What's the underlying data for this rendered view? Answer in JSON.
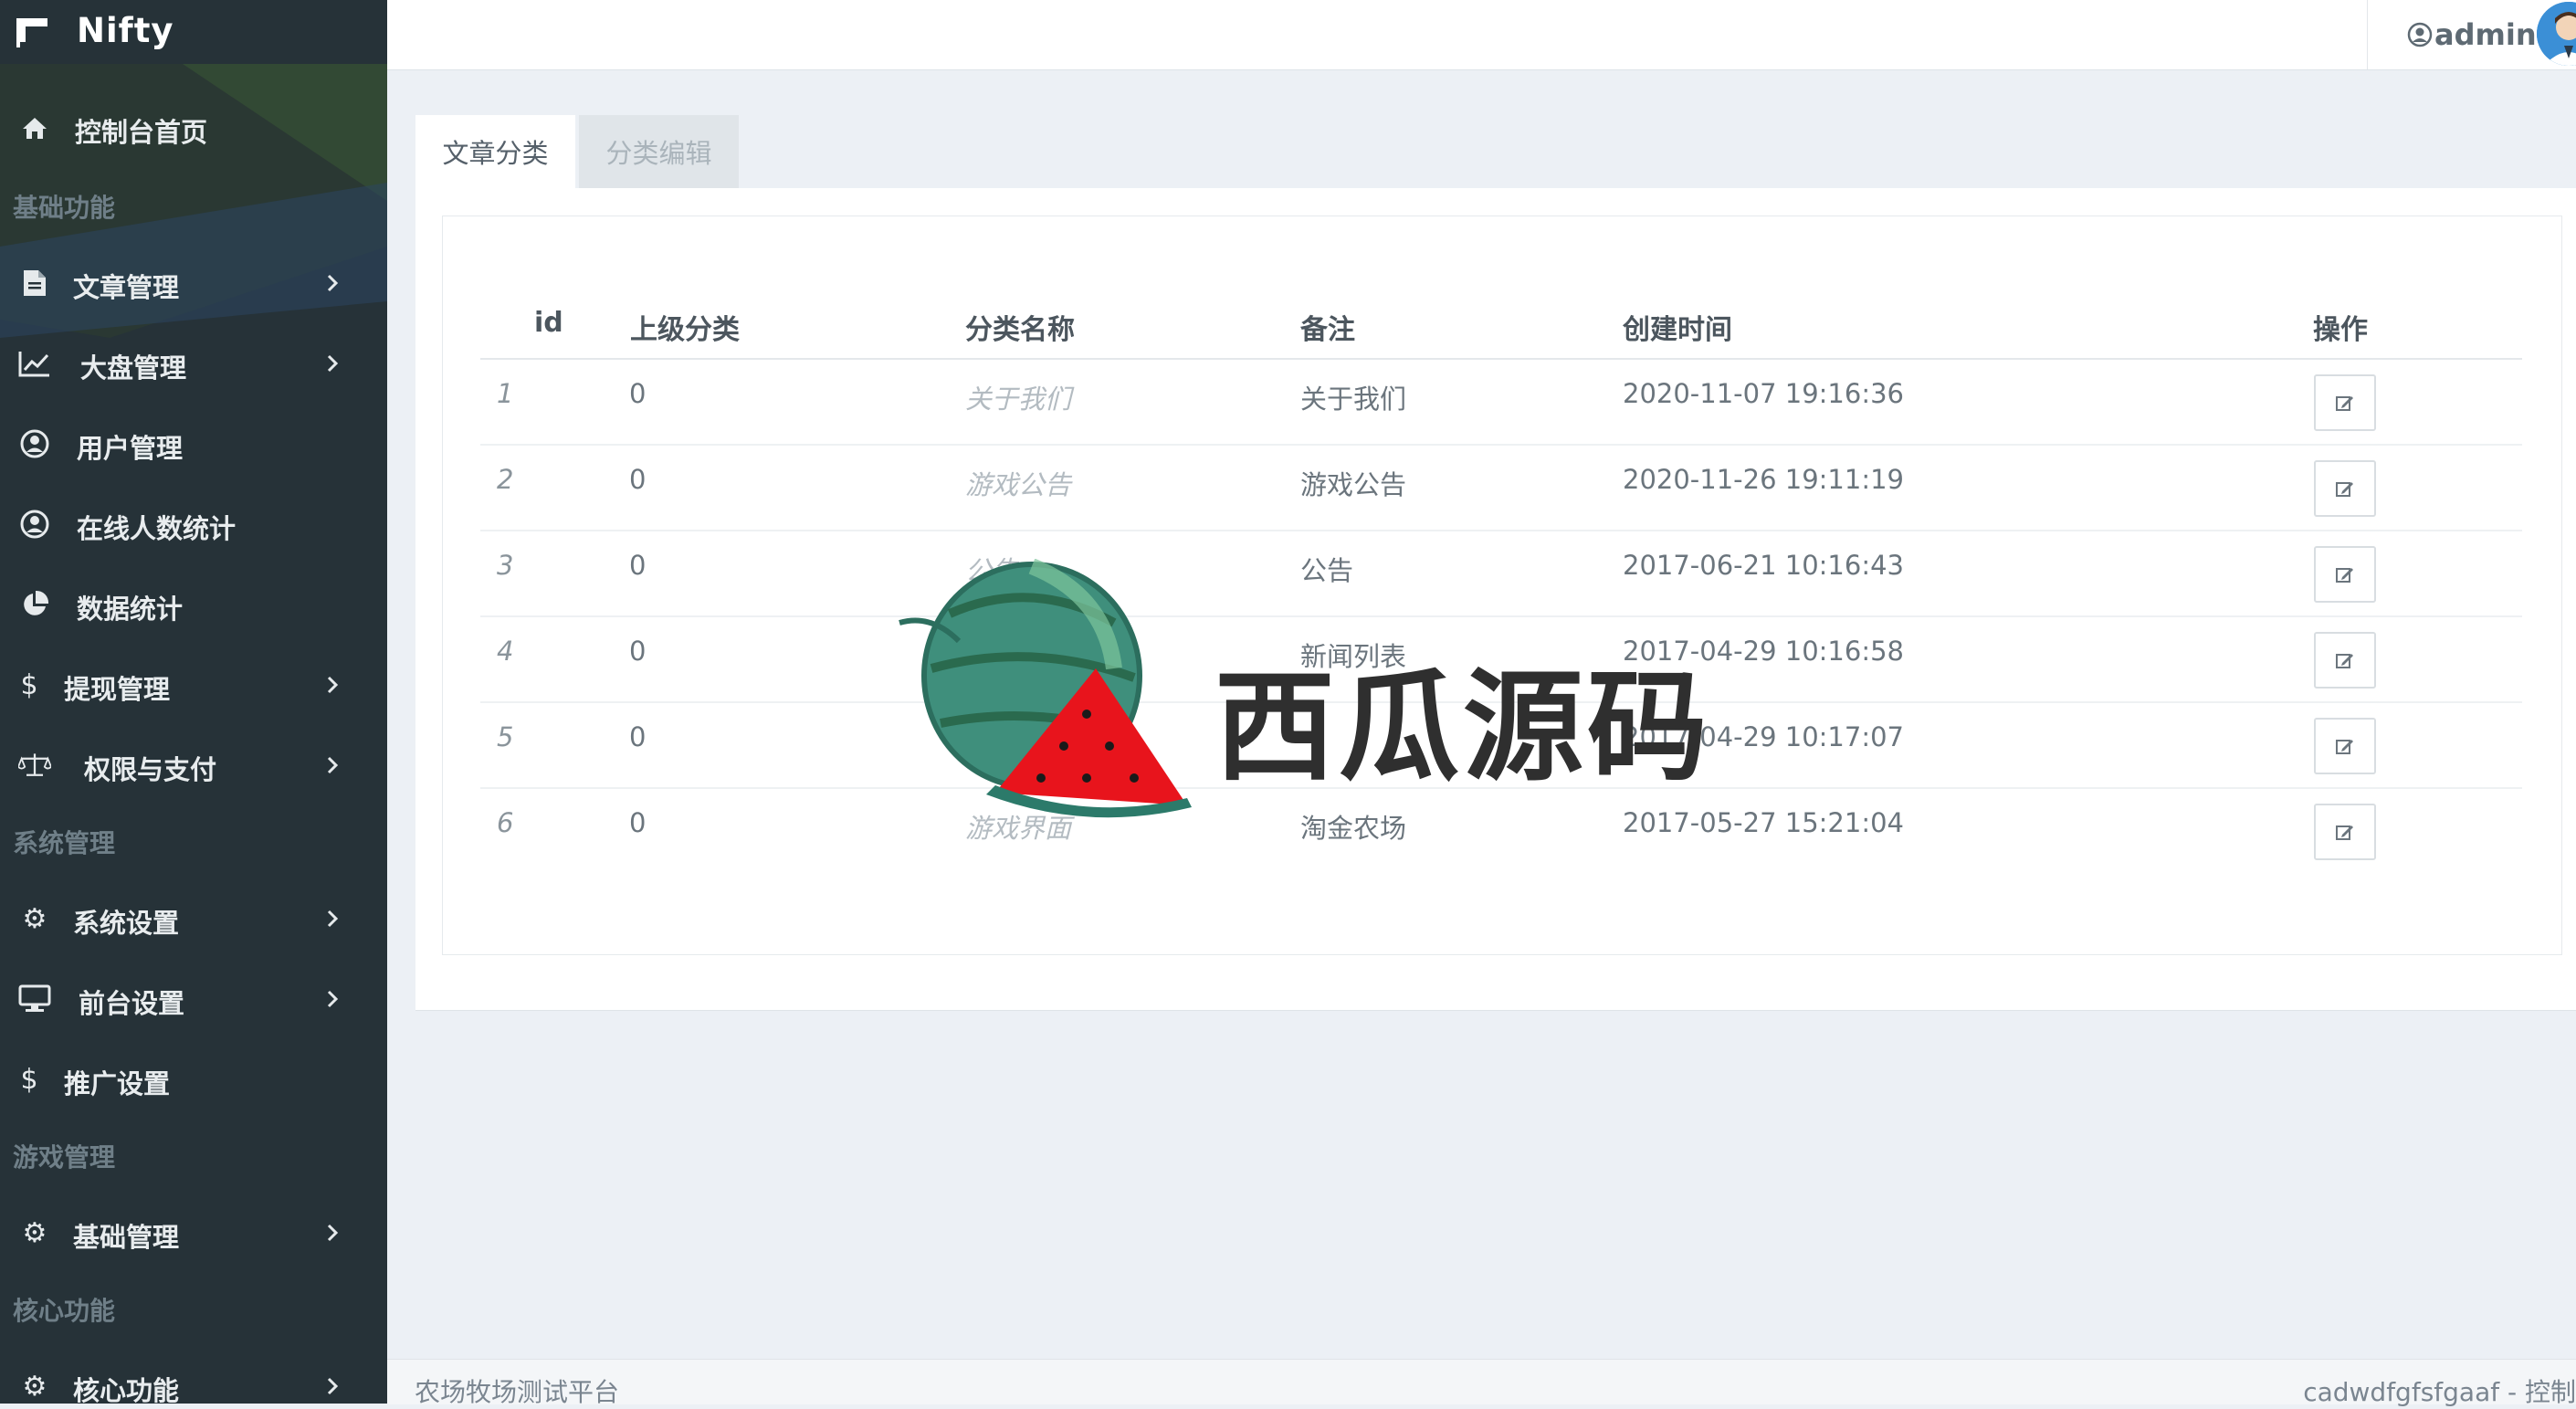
{
  "brand": {
    "name": "Nifty"
  },
  "sidebar": {
    "items": [
      {
        "label": "控制台首页",
        "icon": "home-icon"
      },
      {
        "label": "文章管理",
        "icon": "file-icon"
      },
      {
        "label": "大盘管理",
        "icon": "chart-line-icon"
      },
      {
        "label": "用户管理",
        "icon": "user-circle-icon"
      },
      {
        "label": "在线人数统计",
        "icon": "user-circle-icon"
      },
      {
        "label": "数据统计",
        "icon": "pie-chart-icon"
      },
      {
        "label": "提现管理",
        "icon": "dollar-icon"
      },
      {
        "label": "权限与支付",
        "icon": "balance-scale-icon"
      },
      {
        "label": "系统设置",
        "icon": "gear-icon"
      },
      {
        "label": "前台设置",
        "icon": "desktop-icon"
      },
      {
        "label": "推广设置",
        "icon": "dollar-icon"
      },
      {
        "label": "基础管理",
        "icon": "gear-icon"
      },
      {
        "label": "核心功能",
        "icon": "gear-icon"
      }
    ],
    "sections": [
      "基础功能",
      "系统管理",
      "游戏管理",
      "核心功能"
    ]
  },
  "header": {
    "user": "admin"
  },
  "tabs": [
    {
      "label": "文章分类"
    },
    {
      "label": "分类编辑"
    }
  ],
  "table": {
    "columns": [
      "id",
      "上级分类",
      "分类名称",
      "备注",
      "创建时间",
      "操作"
    ],
    "rows": [
      {
        "id": "1",
        "parent": "0",
        "name": "关于我们",
        "remark": "关于我们",
        "created": "2020-11-07 19:16:36"
      },
      {
        "id": "2",
        "parent": "0",
        "name": "游戏公告",
        "remark": "游戏公告",
        "created": "2020-11-26 19:11:19"
      },
      {
        "id": "3",
        "parent": "0",
        "name": "公告",
        "remark": "公告",
        "created": "2017-06-21 10:16:43"
      },
      {
        "id": "4",
        "parent": "0",
        "name": "",
        "remark": "新闻列表",
        "created": "2017-04-29 10:16:58"
      },
      {
        "id": "5",
        "parent": "0",
        "name": "",
        "remark": "",
        "created": "2017-04-29 10:17:07"
      },
      {
        "id": "6",
        "parent": "0",
        "name": "游戏界面",
        "remark": "淘金农场",
        "created": "2017-05-27 15:21:04"
      }
    ]
  },
  "watermark": {
    "text": "西瓜源码"
  },
  "footer": {
    "left": "农场牧场测试平台",
    "right": "cadwdfgfsfgaaf - 控制"
  },
  "colors": {
    "sidebar_bg": "#263238",
    "page_bg": "#ecf0f5",
    "accent": "#3b8fd6"
  }
}
